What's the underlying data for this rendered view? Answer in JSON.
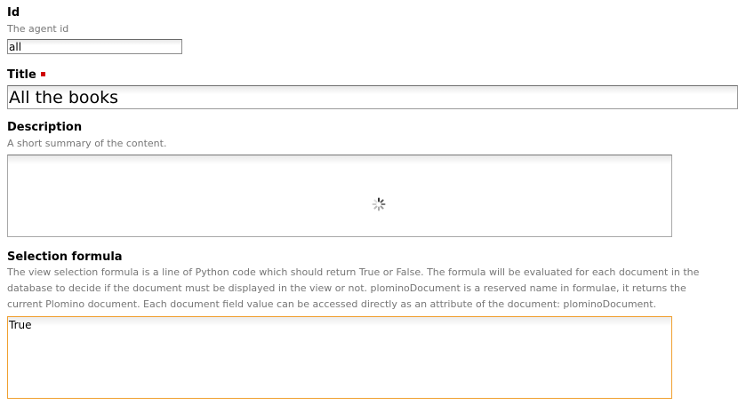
{
  "fields": {
    "id": {
      "label": "Id",
      "help": "The agent id",
      "value": "all"
    },
    "title": {
      "label": "Title",
      "value": "All the books"
    },
    "description": {
      "label": "Description",
      "help": "A short summary of the content.",
      "value": ""
    },
    "selection_formula": {
      "label": "Selection formula",
      "help_line1": "The view selection formula is a line of Python code which should return True or False. The formula will be evaluated for each document in the",
      "help_line2": "database to decide if the document must be displayed in the view or not. plominoDocument is a reserved name in formulae, it returns the",
      "help_line3": "current Plomino document. Each document field value can be accessed directly as an attribute of the document: plominoDocument.",
      "value": "True"
    }
  },
  "colors": {
    "required_marker": "#d00000",
    "focus_border": "#f0a030",
    "help_text": "#767676"
  },
  "icons": {
    "required": "required-marker-icon",
    "loading": "loading-spinner-icon"
  }
}
